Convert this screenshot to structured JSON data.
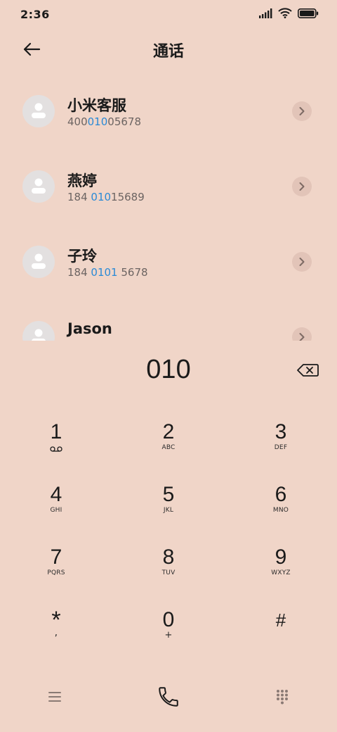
{
  "status_bar": {
    "time": "2:36",
    "icons": [
      "signal-icon",
      "wifi-icon",
      "battery-icon"
    ]
  },
  "header": {
    "title": "通话",
    "back_icon": "arrow-left-icon"
  },
  "contacts": [
    {
      "name": "小米客服",
      "number_parts": [
        "400",
        "010",
        "05678"
      ]
    },
    {
      "name": "燕婷",
      "number_parts": [
        "184 ",
        "010",
        "15689"
      ]
    },
    {
      "name": "子玲",
      "number_parts": [
        "184 ",
        "0101",
        " 5678"
      ]
    },
    {
      "name": "Jason",
      "number_parts": [
        "",
        "",
        ""
      ]
    }
  ],
  "dial": {
    "number": "010",
    "backspace_icon": "backspace-icon"
  },
  "keypad": [
    {
      "digit": "1",
      "letters": "",
      "sub_icon": "voicemail-icon"
    },
    {
      "digit": "2",
      "letters": "ABC"
    },
    {
      "digit": "3",
      "letters": "DEF"
    },
    {
      "digit": "4",
      "letters": "GHI"
    },
    {
      "digit": "5",
      "letters": "JKL"
    },
    {
      "digit": "6",
      "letters": "MNO"
    },
    {
      "digit": "7",
      "letters": "PQRS"
    },
    {
      "digit": "8",
      "letters": "TUV"
    },
    {
      "digit": "9",
      "letters": "WXYZ"
    },
    {
      "digit": "*",
      "letters": ","
    },
    {
      "digit": "0",
      "letters": "+"
    },
    {
      "digit": "#",
      "letters": ""
    }
  ],
  "bottom_bar": {
    "icons": [
      "menu-icon",
      "phone-icon",
      "dialpad-icon"
    ]
  },
  "colors": {
    "background": "#f0d5c8",
    "highlight": "#2a8ad6"
  }
}
